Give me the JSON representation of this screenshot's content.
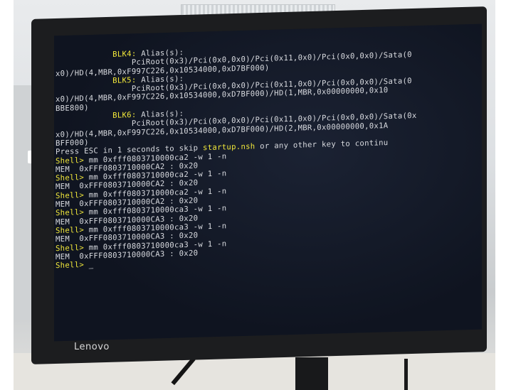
{
  "brand": "Lenovo",
  "terminal_lines": [
    [
      {
        "t": "            "
      },
      {
        "t": "BLK4:",
        "c": "y"
      },
      {
        "t": " Alias(s):"
      }
    ],
    [
      {
        "t": "                PciRoot(0x3)/Pci(0x0,0x0)/Pci(0x11,0x0)/Pci(0x0,0x0)/Sata(0"
      }
    ],
    [
      {
        "t": "x0)/HD(4,MBR,0xF997C226,0x10534000,0xD7BF000)"
      }
    ],
    [
      {
        "t": "            "
      },
      {
        "t": "BLK5:",
        "c": "y"
      },
      {
        "t": " Alias(s):"
      }
    ],
    [
      {
        "t": "                PciRoot(0x3)/Pci(0x0,0x0)/Pci(0x11,0x0)/Pci(0x0,0x0)/Sata(0"
      }
    ],
    [
      {
        "t": "x0)/HD(4,MBR,0xF997C226,0x10534000,0xD7BF000)/HD(1,MBR,0x00000000,0x10"
      }
    ],
    [
      {
        "t": "BBE800)"
      }
    ],
    [
      {
        "t": "            "
      },
      {
        "t": "BLK6:",
        "c": "y"
      },
      {
        "t": " Alias(s):"
      }
    ],
    [
      {
        "t": "                PciRoot(0x3)/Pci(0x0,0x0)/Pci(0x11,0x0)/Pci(0x0,0x0)/Sata(0x"
      }
    ],
    [
      {
        "t": "x0)/HD(4,MBR,0xF997C226,0x10534000,0xD7BF000)/HD(2,MBR,0x00000000,0x1A"
      }
    ],
    [
      {
        "t": "BFF000)"
      }
    ],
    [
      {
        "t": "Press ESC in 1 seconds to skip "
      },
      {
        "t": "startup.nsh",
        "c": "y"
      },
      {
        "t": " or any other key to continu"
      }
    ],
    [
      {
        "t": "Shell>",
        "c": "y"
      },
      {
        "t": " mm 0xfff0803710000ca2 -w 1 -n"
      }
    ],
    [
      {
        "t": "MEM  0xFFF0803710000CA2 : 0x20"
      }
    ],
    [
      {
        "t": "Shell>",
        "c": "y"
      },
      {
        "t": " mm 0xfff0803710000ca2 -w 1 -n"
      }
    ],
    [
      {
        "t": "MEM  0xFFF0803710000CA2 : 0x20"
      }
    ],
    [
      {
        "t": "Shell>",
        "c": "y"
      },
      {
        "t": " mm 0xfff0803710000ca2 -w 1 -n"
      }
    ],
    [
      {
        "t": "MEM  0xFFF0803710000CA2 : 0x20"
      }
    ],
    [
      {
        "t": "Shell>",
        "c": "y"
      },
      {
        "t": " mm 0xfff0803710000ca3 -w 1 -n"
      }
    ],
    [
      {
        "t": "MEM  0xFFF0803710000CA3 : 0x20"
      }
    ],
    [
      {
        "t": "Shell>",
        "c": "y"
      },
      {
        "t": " mm 0xfff0803710000ca3 -w 1 -n"
      }
    ],
    [
      {
        "t": "MEM  0xFFF0803710000CA3 : 0x20"
      }
    ],
    [
      {
        "t": "Shell>",
        "c": "y"
      },
      {
        "t": " mm 0xfff0803710000ca3 -w 1 -n"
      }
    ],
    [
      {
        "t": "MEM  0xFFF0803710000CA3 : 0x20"
      }
    ],
    [
      {
        "t": "Shell>",
        "c": "y"
      },
      {
        "t": " "
      },
      {
        "t": "_",
        "c": "cursor"
      }
    ]
  ],
  "colors": {
    "prompt": "#f2e83a",
    "text": "#d9dbe0",
    "screen": "#111622"
  }
}
